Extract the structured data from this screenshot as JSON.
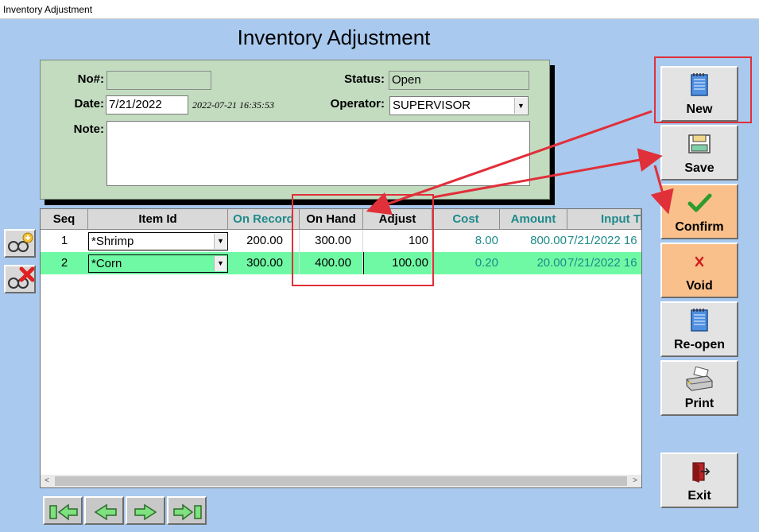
{
  "window": {
    "title": "Inventory Adjustment"
  },
  "page_title": "Inventory Adjustment",
  "header": {
    "no_label": "No#:",
    "no_value": "",
    "date_label": "Date:",
    "date_value": "7/21/2022",
    "timestamp": "2022-07-21 16:35:53",
    "note_label": "Note:",
    "note_value": "",
    "status_label": "Status:",
    "status_value": "Open",
    "operator_label": "Operator:",
    "operator_value": "SUPERVISOR"
  },
  "grid": {
    "columns": [
      "Seq",
      "Item Id",
      "On Record",
      "On Hand",
      "Adjust",
      "Cost",
      "Amount",
      "Input T"
    ],
    "rows": [
      {
        "seq": "1",
        "item": "*Shrimp",
        "on_record": "200.00",
        "on_hand": "300.00",
        "adjust": "100",
        "cost": "8.00",
        "amount": "800.00",
        "input": "7/21/2022 16"
      },
      {
        "seq": "2",
        "item": "*Corn",
        "on_record": "300.00",
        "on_hand": "400.00",
        "adjust": "100.00",
        "cost": "0.20",
        "amount": "20.00",
        "input": "7/21/2022 16"
      }
    ]
  },
  "buttons": {
    "new": "New",
    "save": "Save",
    "confirm": "Confirm",
    "void": "Void",
    "reopen": "Re-open",
    "print": "Print",
    "exit": "Exit"
  },
  "colors": {
    "background": "#a9c9ee",
    "header_panel": "#c3dcc0",
    "selected_row": "#6ff9a4",
    "teal_header": "#1f8a8a",
    "orange_button": "#f9c08b",
    "annotation_red": "#e0303a"
  }
}
